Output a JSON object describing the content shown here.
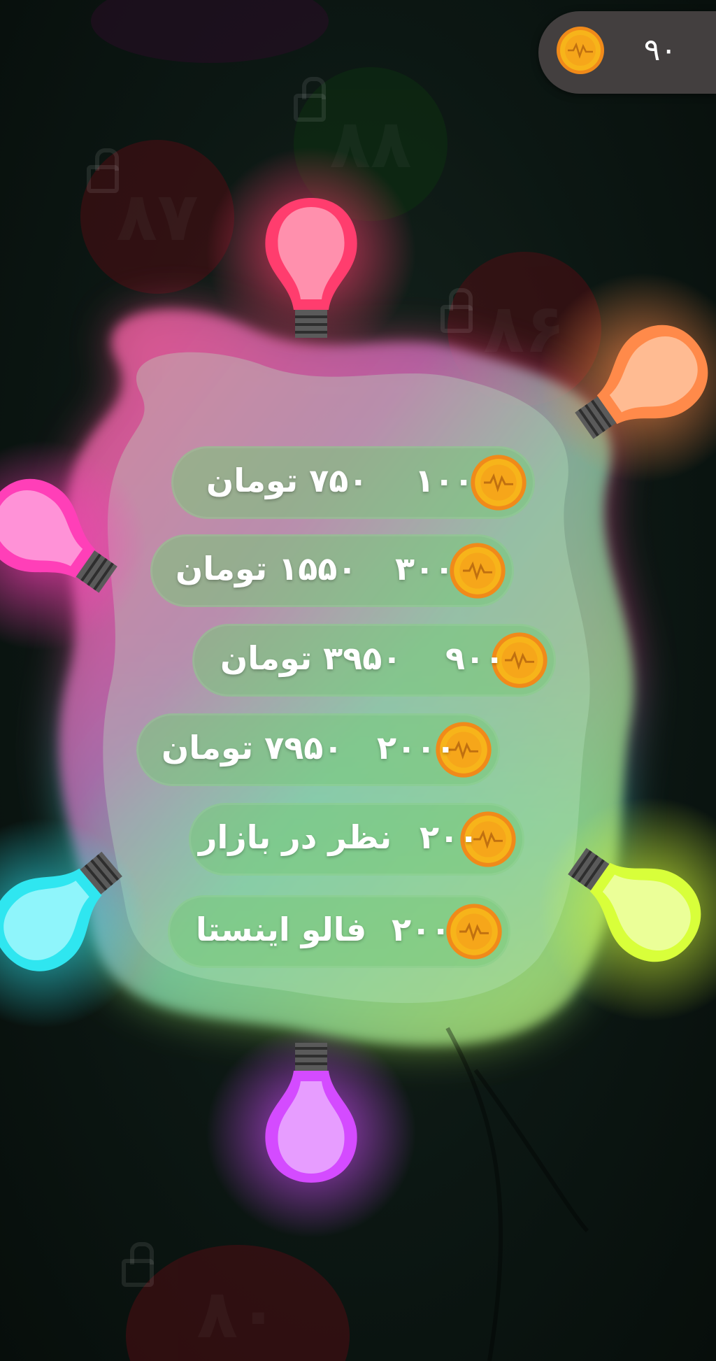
{
  "header": {
    "coin_count": "۹۰",
    "coin_icon": "coin-icon"
  },
  "background_levels": [
    {
      "number": "۸۷",
      "color": "#5a0d12"
    },
    {
      "number": "۸۸",
      "color": "#0e3a12"
    },
    {
      "number": "۸۶",
      "color": "#5a0d12"
    },
    {
      "number": "۸۰",
      "color": "#5a0d12"
    }
  ],
  "shop": {
    "items": [
      {
        "amount": "۱۰۰",
        "price": "۷۵۰ تومان"
      },
      {
        "amount": "۳۰۰",
        "price": "۱۵۵۰ تومان"
      },
      {
        "amount": "۹۰۰",
        "price": "۳۹۵۰ تومان"
      },
      {
        "amount": "۲۰۰۰",
        "price": "۷۹۵۰ تومان"
      },
      {
        "amount": "۲۰۰",
        "price": "نظر در بازار"
      },
      {
        "amount": "۲۰۰",
        "price": "فالو اینستا"
      }
    ]
  },
  "colors": {
    "bulb_red": "#ff3d6e",
    "bulb_orange": "#ff8a4a",
    "bulb_pink": "#ff3fb8",
    "bulb_cyan": "#2fe6f0",
    "bulb_lime": "#d8ff3a",
    "bulb_purple": "#d44bff",
    "coin_gold": "#f7b41a",
    "coin_orange": "#f08a1a"
  }
}
